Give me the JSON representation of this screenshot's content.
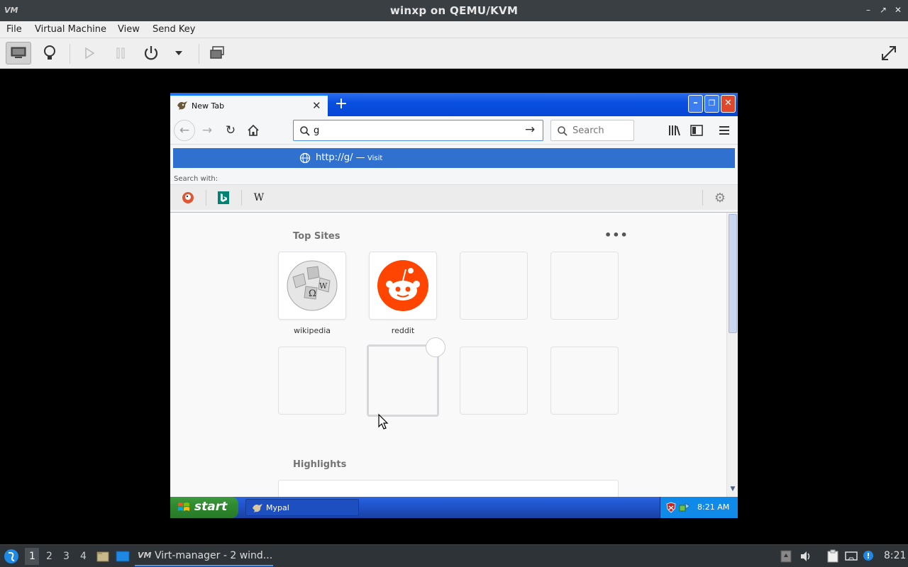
{
  "host": {
    "title": "winxp on QEMU/KVM",
    "app_icon_text": "VM",
    "menu": [
      "File",
      "Virtual Machine",
      "View",
      "Send Key"
    ],
    "toolbar_icons": [
      "monitor-icon",
      "lightbulb-icon",
      "play-icon",
      "pause-icon",
      "power-icon",
      "dropdown-arrow-icon",
      "screenshot-icon",
      "fullscreen-icon"
    ]
  },
  "browser": {
    "tab_title": "New Tab",
    "url_value": "g",
    "search_placeholder": "Search",
    "suggestion_url": "http://g/",
    "suggestion_separator": "—",
    "suggestion_action": "Visit",
    "search_with_label": "Search with:",
    "engines": [
      "duckduckgo",
      "bing",
      "wikipedia"
    ],
    "top_sites_title": "Top Sites",
    "top_sites_menu": "•••",
    "sites": [
      {
        "label": "wikipedia"
      },
      {
        "label": "reddit"
      }
    ],
    "highlights_title": "Highlights"
  },
  "xp": {
    "start_label": "start",
    "task_label": "Mypal",
    "clock": "8:21 AM"
  },
  "panel": {
    "workspaces": [
      "1",
      "2",
      "3",
      "4"
    ],
    "task_label": "Virt-manager - 2 wind...",
    "clock": "8:21"
  },
  "colors": {
    "xp_blue": "#0a50e0",
    "url_selection": "#3071d0",
    "reddit_orange": "#ff4500",
    "host_dark": "#3a3f44"
  }
}
